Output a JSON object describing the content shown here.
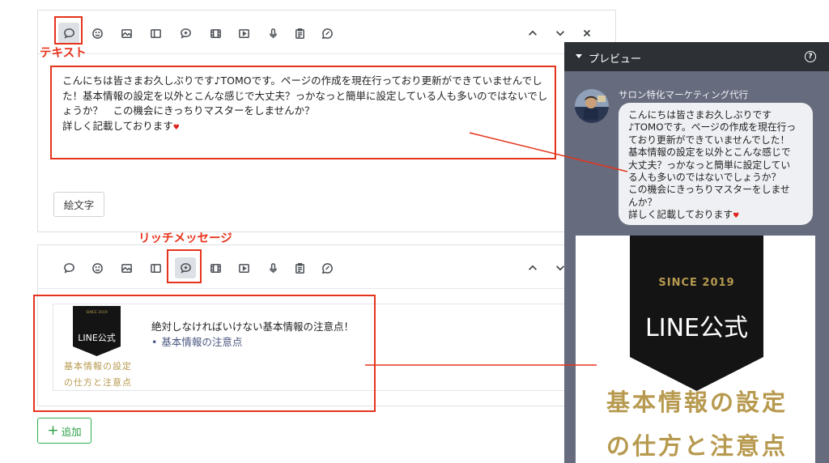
{
  "annotations": {
    "text_label": "テキスト",
    "rich_label": "リッチメッセージ"
  },
  "card1": {
    "message": "こんにちは皆さまお久しぶりです♪TOMOです。ページの作成を現在行っており更新ができていませんでし\nた！基本情報の設定を以外とこんな感じで大丈夫？っかなっと簡単に設定している人も多いのではないでし\nょうか？　この機会にきっちりマスターをしませんか？\n詳しく記載しております",
    "heart": "♥",
    "emoji_button": "絵文字"
  },
  "card2": {
    "rich_title": "絶対しなければいけない基本情報の注意点！",
    "rich_link": "基本情報の注意点"
  },
  "thumb": {
    "since": "SINCE  2019",
    "brand": "LINE公式",
    "line1": "基本情報の設定",
    "line2": "の仕方と注意点"
  },
  "add_button": "追加",
  "preview": {
    "title": "プレビュー",
    "sender": "サロン特化マーケティング代行",
    "bubble_text": "こんにちは皆さまお久しぶりです\n♪TOMOです。ページの作成を現在行っ\nており更新ができていませんでした！\n基本情報の設定を以外とこんな感じで\n大丈夫？っかなっと簡単に設定してい\nる人も多いのではないでしょうか？\nこの機会にきっちりマスターをしませ\nんか？\n詳しく記載しております",
    "heart": "♥"
  },
  "colors": {
    "annotation": "#e5341d",
    "preview_bg": "#666b7e",
    "preview_header": "#2d3035",
    "add_green": "#2ab04b",
    "poster_gold": "#b79a4f"
  },
  "toolbar_icons": [
    "speech-bubble-icon",
    "smiley-icon",
    "image-icon",
    "card-layout-icon",
    "rich-message-icon",
    "film-icon",
    "video-play-icon",
    "microphone-icon",
    "clipboard-icon",
    "survey-bubble-icon"
  ]
}
